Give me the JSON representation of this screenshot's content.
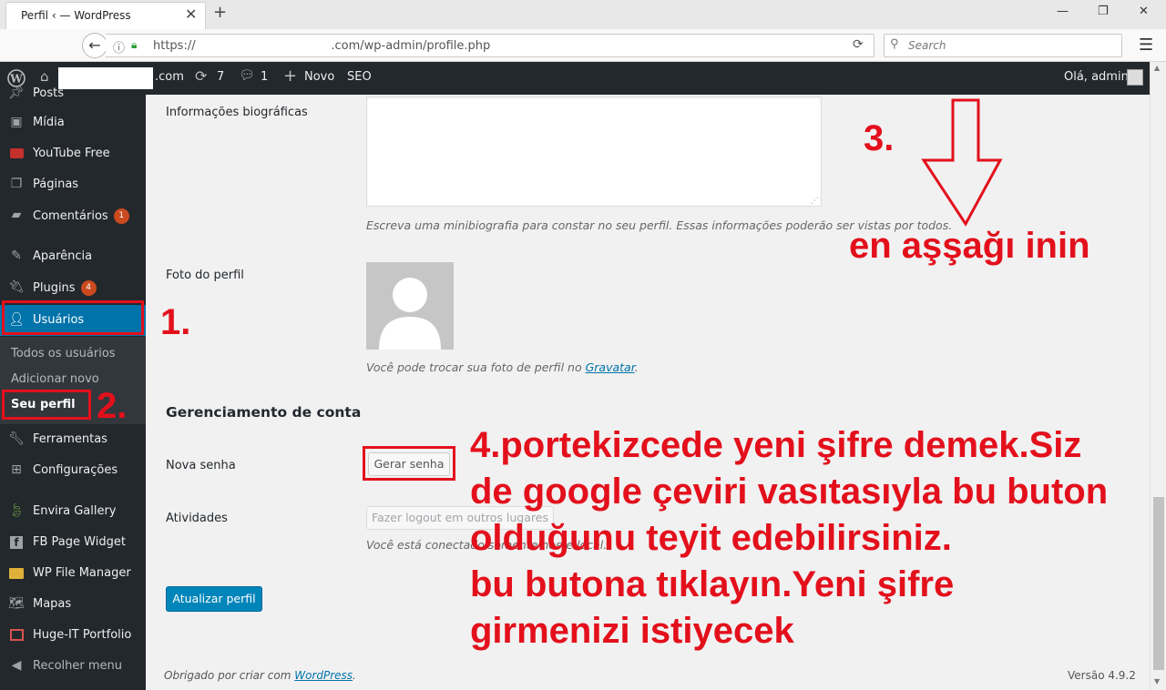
{
  "browser": {
    "tab_title": "Perfil ‹ — WordPress",
    "url": "https://                                    .com/wp-admin/profile.php",
    "search_placeholder": "Search"
  },
  "adminbar": {
    "site_suffix": ".com",
    "updates_count": "7",
    "comments_count": "1",
    "new_label": "Novo",
    "seo_label": "SEO",
    "greeting": "Olá, admin"
  },
  "sidebar": {
    "items": [
      {
        "label": "Posts",
        "icon": "pin-icon"
      },
      {
        "label": "Mídia",
        "icon": "media-icon"
      },
      {
        "label": "YouTube Free",
        "icon": "youtube-icon"
      },
      {
        "label": "Páginas",
        "icon": "pages-icon"
      },
      {
        "label": "Comentários",
        "icon": "comments-icon",
        "badge": "1"
      },
      {
        "label": "Aparência",
        "icon": "brush-icon"
      },
      {
        "label": "Plugins",
        "icon": "plugin-icon",
        "badge": "4"
      },
      {
        "label": "Usuários",
        "icon": "user-icon"
      },
      {
        "label": "Ferramentas",
        "icon": "wrench-icon"
      },
      {
        "label": "Configurações",
        "icon": "settings-icon"
      },
      {
        "label": "Envira Gallery",
        "icon": "leaf-icon"
      },
      {
        "label": "FB Page Widget",
        "icon": "facebook-icon"
      },
      {
        "label": "WP File Manager",
        "icon": "folder-icon"
      },
      {
        "label": "Mapas",
        "icon": "map-icon"
      },
      {
        "label": "Huge-IT Portfolio",
        "icon": "portfolio-icon"
      },
      {
        "label": "Recolher menu",
        "icon": "collapse-icon"
      }
    ],
    "submenu": [
      "Todos os usuários",
      "Adicionar novo",
      "Seu perfil"
    ]
  },
  "main": {
    "bio_label": "Informações biográficas",
    "bio_desc": "Escreva uma minibiografia para constar no seu perfil. Essas informações poderão ser vistas por todos.",
    "photo_label": "Foto do perfil",
    "photo_desc": "Você pode trocar sua foto de perfil no",
    "gravatar_link": "Gravatar",
    "photo_desc_end": ".",
    "account_heading": "Gerenciamento de conta",
    "new_password_label": "Nova senha",
    "generate_password_button": "Gerar senha",
    "sessions_label": "Atividades",
    "logout_everywhere_button": "Fazer logout em outros lugares",
    "sessions_desc": "Você está conectado somente neste local.",
    "update_button": "Atualizar perfil",
    "footer_text": "Obrigado por criar com",
    "footer_link": "WordPress",
    "footer_end": ".",
    "version": "Versão 4.9.2"
  },
  "annotations": {
    "step1": "1.",
    "step2": "2.",
    "step3": "3.",
    "step3_text": "en aşşağı inin",
    "step4_lines": [
      "4.portekizcede yeni şifre demek.Siz",
      "de google çeviri vasıtasıyla bu buton",
      "olduğunu teyit edebilirsiniz.",
      "bu butona tıklayın.Yeni şifre",
      "girmenizi istiyecek"
    ],
    "color": "#e3101c"
  }
}
